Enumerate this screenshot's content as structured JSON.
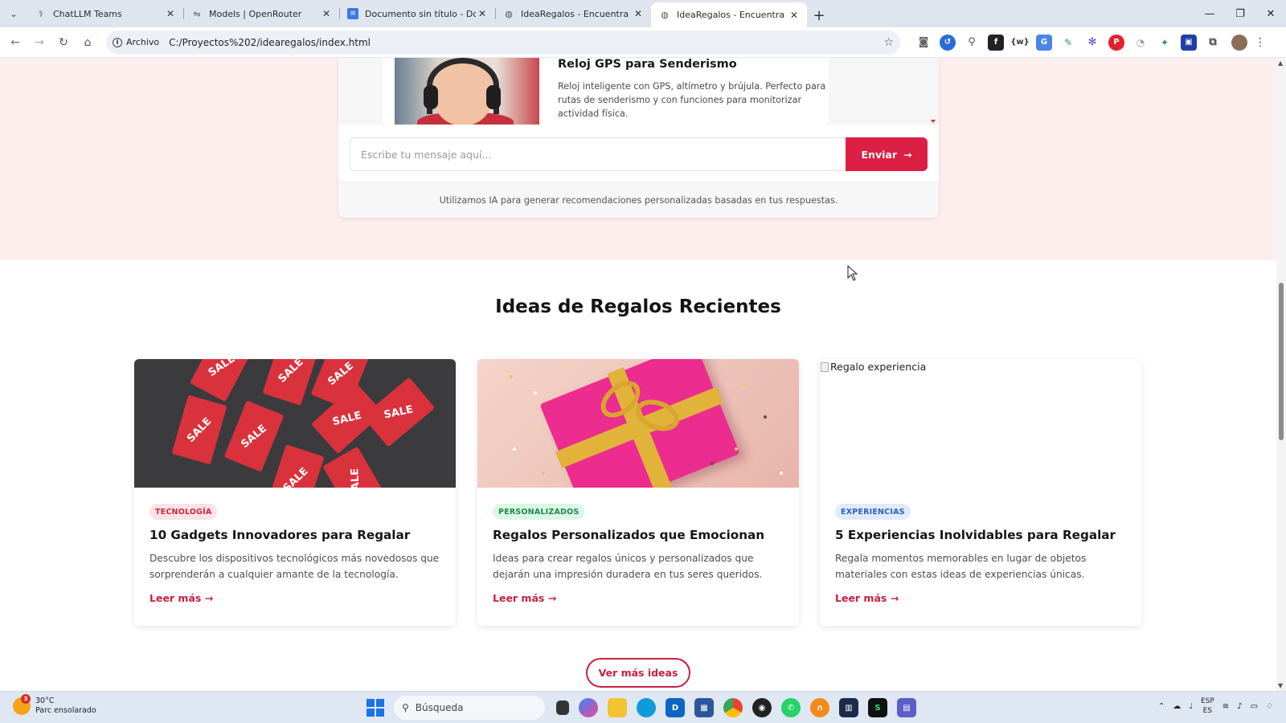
{
  "browser": {
    "tabs": [
      {
        "title": "ChatLLM Teams",
        "active": false,
        "icon": "chatllm-icon"
      },
      {
        "title": "Models | OpenRouter",
        "active": false,
        "icon": "openrouter-icon"
      },
      {
        "title": "Documento sin título - Docume",
        "active": false,
        "icon": "docs-icon"
      },
      {
        "title": "IdeaRegalos - Encuentra el Reg",
        "active": false,
        "icon": "globe-icon"
      },
      {
        "title": "IdeaRegalos - Encuentra el Reg",
        "active": true,
        "icon": "globe-icon"
      }
    ],
    "address": {
      "chip_label": "Archivo",
      "url": "C:/Proyectos%202/idearegalos/index.html"
    }
  },
  "chat": {
    "product": {
      "title": "Reloj GPS para Senderismo",
      "description": "Reloj inteligente con GPS, altímetro y brújula. Perfecto para rutas de senderismo y con funciones para monitorizar actividad física."
    },
    "input_placeholder": "Escribe tu mensaje aquí...",
    "send_label": "Enviar",
    "footer_note": "Utilizamos IA para generar recomendaciones personalizadas basadas en tus respuestas."
  },
  "recent": {
    "title": "Ideas de Regalos Recientes",
    "cards": [
      {
        "badge": "TECNOLOGÍA",
        "title": "10 Gadgets Innovadores para Regalar",
        "description": "Descubre los dispositivos tecnológicos más novedosos que sorprenderán a cualquier amante de la tecnología.",
        "link": "Leer más →",
        "image_alt": ""
      },
      {
        "badge": "PERSONALIZADOS",
        "title": "Regalos Personalizados que Emocionan",
        "description": "Ideas para crear regalos únicos y personalizados que dejarán una impresión duradera en tus seres queridos.",
        "link": "Leer más →",
        "image_alt": ""
      },
      {
        "badge": "EXPERIENCIAS",
        "title": "5 Experiencias Inolvidables para Regalar",
        "description": "Regala momentos memorables en lugar de objetos materiales con estas ideas de experiencias únicas.",
        "link": "Leer más →",
        "image_alt": "Regalo experiencia"
      }
    ],
    "more_button": "Ver más ideas",
    "sale_word": "SALE"
  },
  "taskbar": {
    "weather_temp": "30°C",
    "weather_desc": "Parc ensolarado",
    "weather_badge": "3",
    "search_placeholder": "Búsqueda",
    "lang_top": "ESP",
    "lang_bottom": "ES"
  },
  "colors": {
    "accent": "#db1f45",
    "hero_bg": "#fdeeee",
    "tab_strip": "#dfe5ee"
  }
}
